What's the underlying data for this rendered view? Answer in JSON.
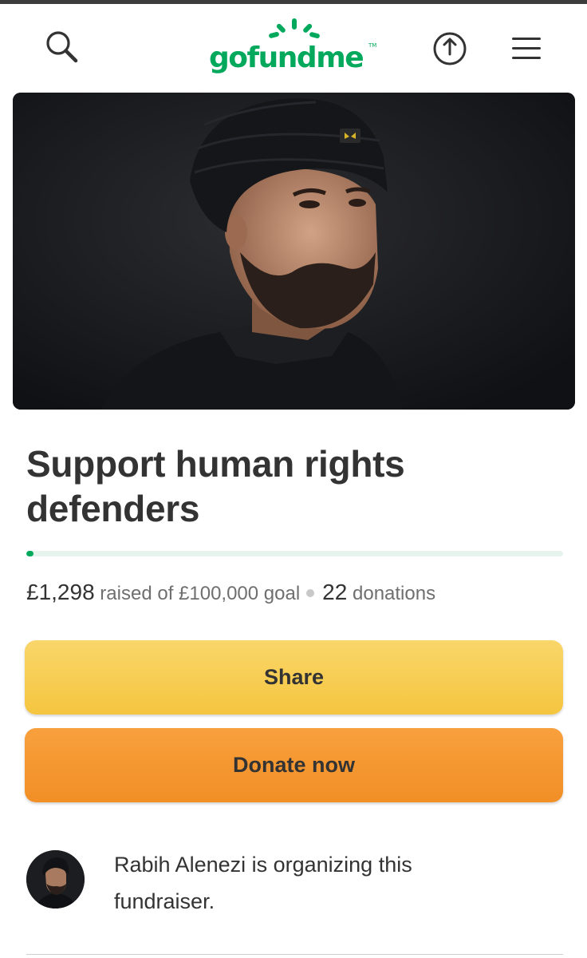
{
  "header": {
    "logo_text": "gofundme",
    "logo_tm": "TM",
    "icons": {
      "search": "search-icon",
      "share": "share-upload-icon",
      "menu": "menu-icon"
    }
  },
  "hero": {
    "image": "organizer-portrait-photo"
  },
  "campaign": {
    "title": "Support human rights defenders",
    "raised_amount": "£1,298",
    "raised_of_text": " raised of £100,000 goal",
    "donation_count": "22",
    "donations_label": " donations",
    "progress_fraction": 0.013
  },
  "actions": {
    "share_label": "Share",
    "donate_label": "Donate now"
  },
  "organizer": {
    "text": "Rabih Alenezi is organizing this fundraiser."
  },
  "colors": {
    "brand_green": "#02a95c",
    "share_yellow": "#f5c53f",
    "donate_orange": "#f28f26",
    "text_dark": "#333333",
    "text_muted": "#6f6f6f"
  }
}
